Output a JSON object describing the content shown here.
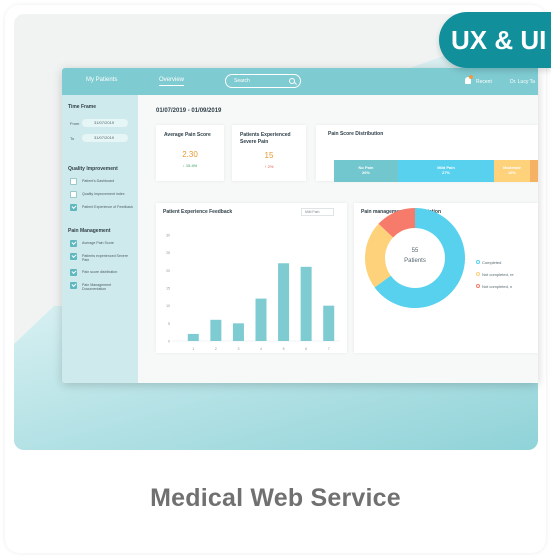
{
  "badge": "UX & UI",
  "caption": "Medical Web Service",
  "topbar": {
    "tabs": [
      "My Patients",
      "Overview"
    ],
    "search_placeholder": "Search",
    "recent": "Recent",
    "user": "Dr. Lucy Ta"
  },
  "sidebar": {
    "time_frame": "Time Frame",
    "from_label": "From",
    "from_date": "31/07/2019",
    "to_label": "To",
    "to_date": "31/07/2019",
    "quality_heading": "Quality Improvement",
    "quality_items": [
      {
        "label": "Patient's Dashboard",
        "checked": false
      },
      {
        "label": "Quality improvement index",
        "checked": false
      },
      {
        "label": "Patient Experience of Feedback",
        "checked": true
      }
    ],
    "pain_heading": "Pain Management",
    "pain_items": [
      {
        "label": "Average Pain Score",
        "checked": true
      },
      {
        "label": "Patients experienced Severe Pain",
        "checked": true
      },
      {
        "label": "Pain score distribution",
        "checked": true
      },
      {
        "label": "Pain Management Documentation",
        "checked": true
      }
    ]
  },
  "main": {
    "date_range": "01/07/2019 - 01/09/2019",
    "kpis": [
      {
        "title": "Average Pain Score",
        "value": "2.30",
        "delta": "↓ 15.4%",
        "color": "#e39a32",
        "delta_color": "#2e9b5b"
      },
      {
        "title": "Patients Experienced Severe Pain",
        "value": "15",
        "delta": "↑ 2%",
        "color": "#e39a32",
        "delta_color": "#d9534f"
      }
    ],
    "distribution": {
      "title": "Pain Score Distribution",
      "segments": [
        {
          "label": "No Pain",
          "value": "26%",
          "color": "#72c6cd"
        },
        {
          "label": "Mild Pain",
          "value": "27%",
          "color": "#57d1ee"
        },
        {
          "label": "Moderate",
          "value": "16%",
          "color": "#fdd27a"
        },
        {
          "label": "",
          "value": "",
          "color": "#f6b264"
        }
      ]
    },
    "feedback": {
      "title": "Patient Experience Feedback",
      "select": "Mild Pain"
    },
    "documentation": {
      "title": "Pain management documentation",
      "center_count": "55",
      "center_label": "Patients",
      "legend": [
        {
          "label": "Completed",
          "color": "#57d1ee"
        },
        {
          "label": "Not completed, re",
          "color": "#fdd27a"
        },
        {
          "label": "Not completed, n",
          "color": "#f77b6b"
        }
      ]
    }
  },
  "chart_data": {
    "type": "bar",
    "title": "Patient Experience Feedback",
    "categories": [
      "1",
      "2",
      "3",
      "4",
      "5",
      "6",
      "7"
    ],
    "values": [
      2,
      6,
      5,
      12,
      22,
      21,
      10
    ],
    "yticks": [
      "0",
      "5",
      "10",
      "15",
      "20",
      "25",
      "30"
    ],
    "ylim": [
      0,
      30
    ],
    "bar_color": "#7ecbd1",
    "xlabel": "",
    "ylabel": ""
  },
  "donut_data": {
    "type": "pie",
    "labels": [
      "Completed",
      "Not completed, re",
      "Not completed, n"
    ],
    "values": [
      65,
      22,
      13
    ],
    "colors": [
      "#57d1ee",
      "#fdd27a",
      "#f77b6b"
    ]
  }
}
